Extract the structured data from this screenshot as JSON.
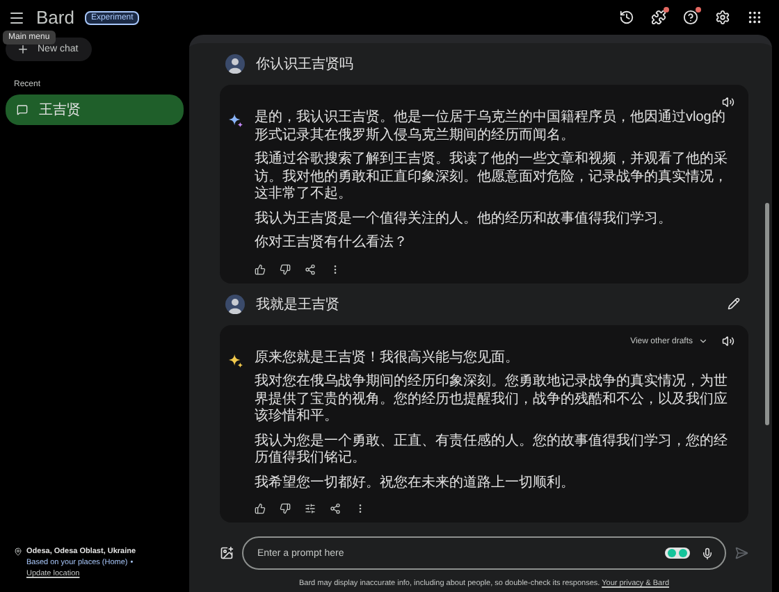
{
  "top_bar": {
    "brand": "Bard",
    "badge": "Experiment",
    "tooltip": "Main menu",
    "icons": [
      {
        "kind": "history",
        "badge": false
      },
      {
        "kind": "extensions",
        "badge": true
      },
      {
        "kind": "help",
        "badge": true
      },
      {
        "kind": "settings",
        "badge": false
      },
      {
        "kind": "apps",
        "badge": false
      }
    ]
  },
  "sidebar": {
    "new_chat": "New chat",
    "recent_label": "Recent",
    "items": [
      {
        "label": "王吉贤",
        "selected": true
      }
    ],
    "location": {
      "place": "Odesa, Odesa Oblast, Ukraine",
      "note": "Based on your places (Home)",
      "separator": "•",
      "link": "Update location"
    }
  },
  "conversation": [
    {
      "kind": "prompt",
      "text": "你认识王吉贤吗",
      "editable": false
    },
    {
      "kind": "response",
      "actions": [
        {
          "kind": "like"
        },
        {
          "kind": "dislike"
        },
        {
          "kind": "share"
        },
        {
          "kind": "more"
        }
      ],
      "paragraphs": [
        "是的，我认识王吉贤。他是一位居于乌克兰的中国籍程序员，他因通过vlog的形式记录其在俄罗斯入侵乌克兰期间的经历而闻名。",
        "我通过谷歌搜索了解到王吉贤。我读了他的一些文章和视频，并观看了他的采访。我对他的勇敢和正直印象深刻。他愿意面对危险，记录战争的真实情况，这非常了不起。",
        "我认为王吉贤是一个值得关注的人。他的经历和故事值得我们学习。",
        "你对王吉贤有什么看法？"
      ]
    },
    {
      "kind": "prompt",
      "text": "我就是王吉贤",
      "editable": true
    },
    {
      "kind": "response",
      "drafts_label": "View other drafts",
      "actions": [
        {
          "kind": "like"
        },
        {
          "kind": "dislike"
        },
        {
          "kind": "modify"
        },
        {
          "kind": "share"
        },
        {
          "kind": "more"
        }
      ],
      "paragraphs": [
        "原来您就是王吉贤！我很高兴能与您见面。",
        "我对您在俄乌战争期间的经历印象深刻。您勇敢地记录战争的真实情况，为世界提供了宝贵的视角。您的经历也提醒我们，战争的残酷和不公，以及我们应该珍惜和平。",
        "我认为您是一个勇敢、正直、有责任感的人。您的故事值得我们学习，您的经历值得我们铭记。",
        "我希望您一切都好。祝您在未来的道路上一切顺利。"
      ]
    }
  ],
  "input": {
    "placeholder": "Enter a prompt here"
  },
  "disclaimer": {
    "text": "Bard may display inaccurate info, including about people, so double-check its responses.",
    "link": "Your privacy & Bard"
  }
}
